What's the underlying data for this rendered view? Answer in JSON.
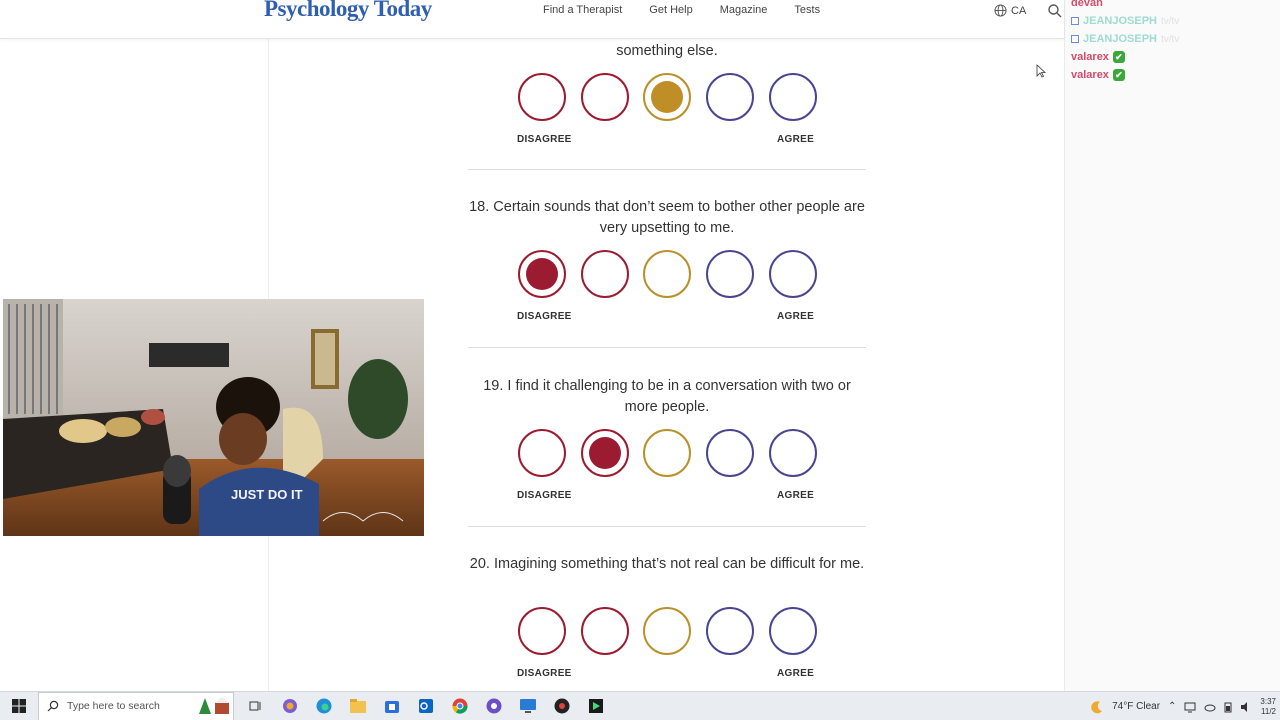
{
  "site": {
    "logo": "Psychology Today",
    "nav": [
      "Find a Therapist",
      "Get Help",
      "Magazine",
      "Tests"
    ],
    "locale": "CA"
  },
  "chat": [
    {
      "user": "devan",
      "msg": "",
      "badge": false,
      "faded": false
    },
    {
      "user": "JEANJOSEPH",
      "msg": "tv/tv",
      "badge": false,
      "faded": true
    },
    {
      "user": "JEANJOSEPH",
      "msg": "tv/tv",
      "badge": false,
      "faded": true
    },
    {
      "user": "valarex",
      "msg": "",
      "badge": true,
      "faded": false
    },
    {
      "user": "valarex",
      "msg": "",
      "badge": true,
      "faded": false
    }
  ],
  "quiz": {
    "scale_left": "DISAGREE",
    "scale_right": "AGREE",
    "option_colors": [
      "#9b1b30",
      "#9b1b30",
      "#b8912a",
      "#4b4590",
      "#4b4590"
    ],
    "selected_color_red": "#9b1b30",
    "selected_color_gold": "#bf8e26",
    "questions": [
      {
        "text": "something else.",
        "selected": 3
      },
      {
        "text": "18. Certain sounds that don’t seem to bother other people are very upsetting to me.",
        "selected": 1
      },
      {
        "text": "19. I find it challenging to be in a conversation with two or more people.",
        "selected": 2
      },
      {
        "text": "20. Imagining something that’s not real can be difficult for me.",
        "selected": 0
      }
    ]
  },
  "webcam": {
    "shirt_text": "JUST DO IT"
  },
  "taskbar": {
    "search_placeholder": "Type here to search",
    "weather": "74°F  Clear",
    "time": "3:37",
    "date": "11/2"
  }
}
